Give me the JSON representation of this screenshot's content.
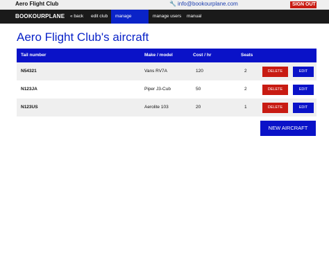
{
  "topbar": {
    "club_name": "Aero Flight Club",
    "contact_email": "info@bookourplane.com",
    "signout_label": "SIGN OUT",
    "signout_icon": "exit-arrow-icon"
  },
  "nav": {
    "brand": "BOOKOURPLANE",
    "items": [
      {
        "label": "« back",
        "active": false
      },
      {
        "label": "edit club",
        "active": false
      },
      {
        "label": "manage aircraft",
        "active": true
      },
      {
        "label": "manage users",
        "active": false
      },
      {
        "label": "manual",
        "active": false
      }
    ]
  },
  "page": {
    "title": "Aero Flight Club's aircraft"
  },
  "table": {
    "headers": [
      "Tail number",
      "Make / model",
      "Cost / hr",
      "Seats"
    ],
    "rows": [
      {
        "tail": "N54321",
        "model": "Vans RV7A",
        "cost": "120",
        "seats": "2"
      },
      {
        "tail": "N123JA",
        "model": "Piper J3-Cub",
        "cost": "50",
        "seats": "2"
      },
      {
        "tail": "N123US",
        "model": "Aerolite 103",
        "cost": "20",
        "seats": "1"
      }
    ],
    "delete_label": "DELETE",
    "edit_label": "EDIT"
  },
  "actions": {
    "new_aircraft_label": "NEW AIRCRAFT"
  },
  "colors": {
    "accent_blue": "#0a12c8",
    "danger_red": "#c81b12",
    "navbar_bg": "#1a1a1a"
  }
}
